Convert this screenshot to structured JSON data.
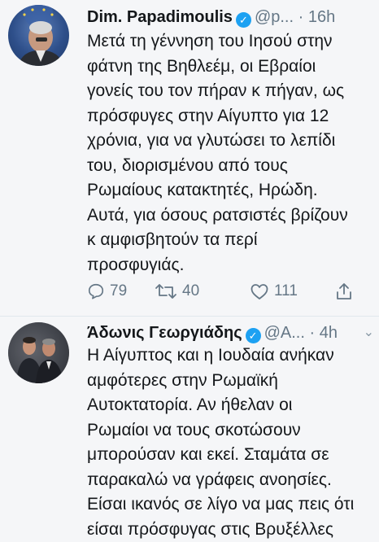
{
  "tweets": [
    {
      "name": "Dim. Papadimoulis",
      "handle": "@p...",
      "time": "· 16h",
      "lines": [
        "Μετά τη γέννηση του Ιησού στην",
        "φάτνη της Βηθλεέμ, οι Εβραίοι",
        "γονείς του τον πήραν κ πήγαν, ως",
        "πρόσφυγες στην Αίγυπτο για 12",
        "χρόνια, για να γλυτώσει το λεπίδι",
        "του, διορισμένου από τους",
        "Ρωμαίους κατακτητές, Ηρώδη.",
        "Αυτά, για όσους  ρατσιστές βρίζουν",
        "κ αμφισβητούν τα περί",
        "προσφυγιάς."
      ],
      "replies": "79",
      "retweets": "40",
      "likes": "111"
    },
    {
      "name": "Άδωνις Γεωργιάδης",
      "handle": "@A...",
      "time": "· 4h",
      "lines": [
        "Η Αίγυπτος και η Ιουδαία ανήκαν",
        "αμφότερες στην Ρωμαϊκή",
        "Αυτοκτατορία. Αν ήθελαν οι",
        "Ρωμαίοι να τους σκοτώσουν",
        "μπορούσαν και εκεί. Σταμάτα σε",
        "παρακαλώ να γράφεις ανοησίες.",
        "Είσαι ικανός σε λίγο να μας πεις ότι",
        "είσαι πρόσφυγας στις Βρυξέλλες"
      ]
    }
  ],
  "colors": {
    "verified": "#1da1f2",
    "muted": "#657786",
    "text": "#14171a"
  },
  "icons": [
    "reply-icon",
    "retweet-icon",
    "like-icon",
    "share-icon",
    "verified-badge-icon",
    "chevron-down-icon"
  ]
}
